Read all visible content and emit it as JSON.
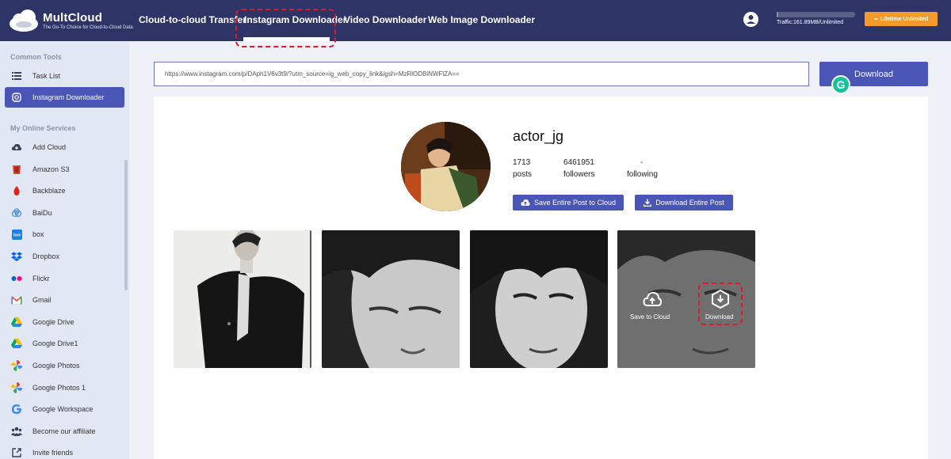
{
  "app": {
    "brand": "MultCloud",
    "tagline": "The Go-To Choice for Cloud-to-Cloud Data"
  },
  "nav": {
    "items": [
      {
        "label": "Cloud-to-cloud Transfer"
      },
      {
        "label": "Instagram Downloader"
      },
      {
        "label": "Video Downloader"
      },
      {
        "label": "Web Image Downloader"
      }
    ],
    "active": "Instagram Downloader"
  },
  "account": {
    "traffic": "Traffic:161.89MB/Unlimited",
    "traffic_used_fraction": 0.02,
    "plan_label": "Lifetime Unlimited"
  },
  "sidebar": {
    "common_heading": "Common Tools",
    "common_items": [
      {
        "label": "Task List",
        "icon": "list-icon"
      },
      {
        "label": "Instagram Downloader",
        "icon": "instagram-icon"
      }
    ],
    "services_heading": "My Online Services",
    "services": [
      {
        "label": "Add Cloud",
        "icon": "cloud-add-icon"
      },
      {
        "label": "Amazon S3",
        "icon": "amazon-s3-icon"
      },
      {
        "label": "Backblaze",
        "icon": "backblaze-icon"
      },
      {
        "label": "BaiDu",
        "icon": "baidu-icon"
      },
      {
        "label": "box",
        "icon": "box-icon"
      },
      {
        "label": "Dropbox",
        "icon": "dropbox-icon"
      },
      {
        "label": "Flickr",
        "icon": "flickr-icon"
      },
      {
        "label": "Gmail",
        "icon": "gmail-icon"
      },
      {
        "label": "Google Drive",
        "icon": "google-drive-icon"
      },
      {
        "label": "Google Drive1",
        "icon": "google-drive-icon"
      },
      {
        "label": "Google Photos",
        "icon": "google-photos-icon"
      },
      {
        "label": "Google Photos 1",
        "icon": "google-photos-icon"
      },
      {
        "label": "Google Workspace",
        "icon": "google-workspace-icon"
      },
      {
        "label": "Become our affiliate",
        "icon": "affiliate-icon"
      },
      {
        "label": "Invite friends",
        "icon": "invite-icon"
      }
    ]
  },
  "search": {
    "url": "https://www.instagram.com/p/DAph1V6v3t9/?utm_source=ig_web_copy_link&igsh=MzRlODBiNWFlZA==",
    "button_label": "Download",
    "grammarly_badge": "G"
  },
  "profile": {
    "username": "actor_jg",
    "posts_count": "1713",
    "posts_label": "posts",
    "followers_count": "6461951",
    "followers_label": "followers",
    "following_count": "-",
    "following_label": "following",
    "save_all_label": "Save Entire Post to Cloud",
    "download_all_label": "Download Entire Post"
  },
  "post_overlay": {
    "save_label": "Save to Cloud",
    "download_label": "Download"
  },
  "colors": {
    "topbar": "#2e3566",
    "accent": "#4a56b6",
    "plan_badge": "#f39a2a",
    "highlight": "#e0192a",
    "sidebar": "#e2e8f3"
  }
}
